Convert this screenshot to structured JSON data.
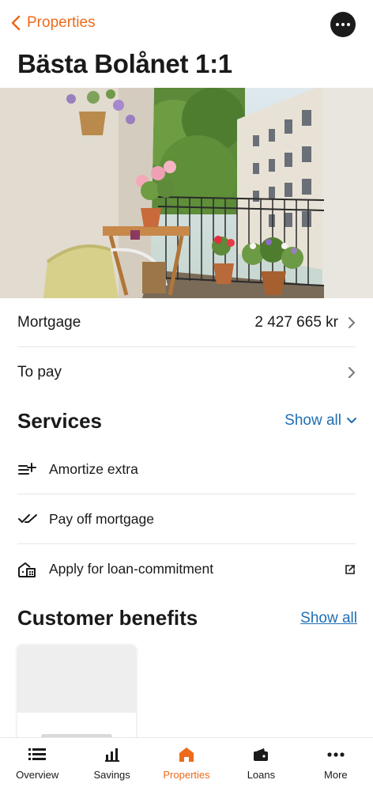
{
  "header": {
    "back_label": "Properties",
    "title": "Bästa Bolånet 1:1"
  },
  "hero": {
    "description": "balcony with flowers, wicker chair and small wooden table"
  },
  "summary": {
    "mortgage_label": "Mortgage",
    "mortgage_value": "2 427 665 kr",
    "topay_label": "To pay"
  },
  "services": {
    "title": "Services",
    "show_all": "Show all",
    "items": [
      {
        "label": "Amortize extra",
        "icon": "amortize-icon"
      },
      {
        "label": "Pay off mortgage",
        "icon": "double-check-icon"
      },
      {
        "label": "Apply for loan-commitment",
        "icon": "house-icon"
      }
    ]
  },
  "benefits": {
    "title": "Customer benefits",
    "show_all": "Show all"
  },
  "tabs": [
    {
      "label": "Overview",
      "icon": "list-icon",
      "active": false
    },
    {
      "label": "Savings",
      "icon": "bar-chart-icon",
      "active": false
    },
    {
      "label": "Properties",
      "icon": "home-icon",
      "active": true
    },
    {
      "label": "Loans",
      "icon": "wallet-icon",
      "active": false
    },
    {
      "label": "More",
      "icon": "more-icon",
      "active": false
    }
  ],
  "colors": {
    "accent": "#ee6a1a",
    "link": "#1f6fb5",
    "text": "#1a1a1a"
  }
}
